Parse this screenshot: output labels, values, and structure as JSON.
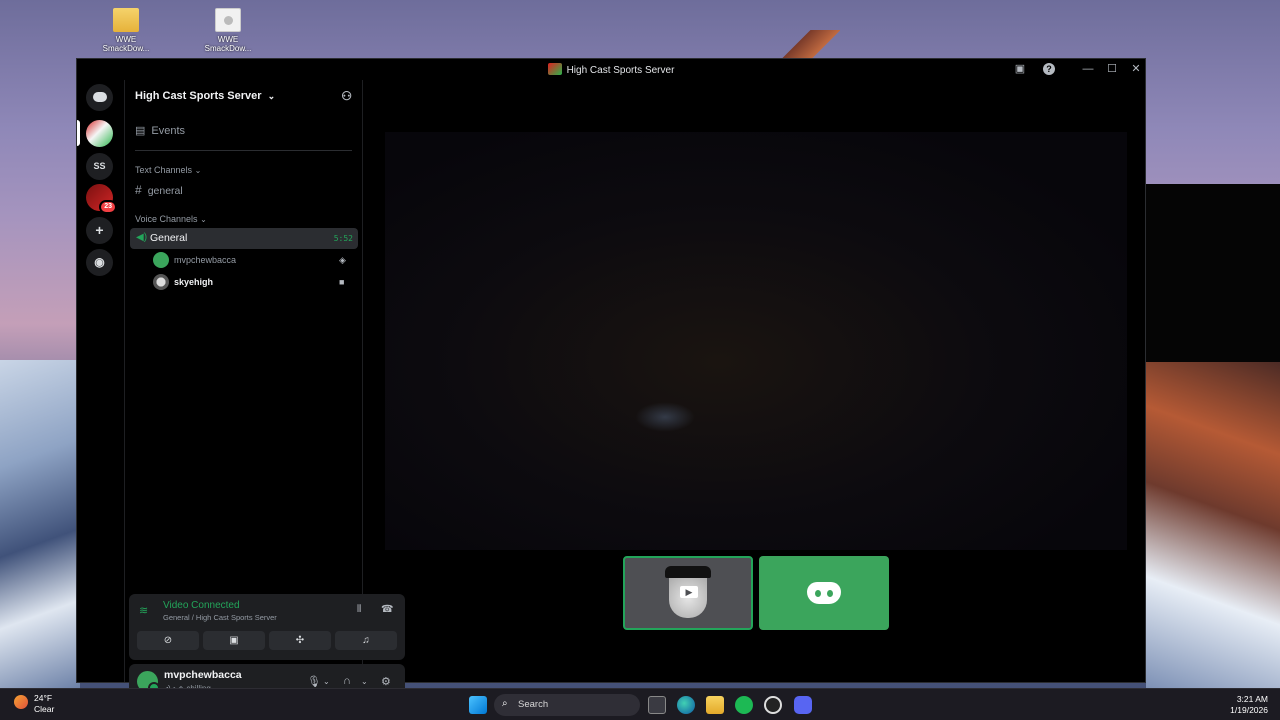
{
  "desktop": {
    "icons": [
      {
        "label": "WWE SmackDow..."
      },
      {
        "label": "WWE SmackDow..."
      }
    ]
  },
  "window": {
    "title": "High Cast Sports Server",
    "controls": {
      "inbox": "▣",
      "help": "?",
      "minimize": "—",
      "maximize": "☐",
      "close": "✕"
    }
  },
  "rail": {
    "servers": [
      {
        "short": "SS"
      }
    ],
    "badge_count": "23"
  },
  "sidebar": {
    "server_name": "High Cast Sports Server",
    "events_label": "Events",
    "text_category": "Text Channels",
    "text_channels": [
      "general"
    ],
    "voice_category": "Voice Channels",
    "voice_channel": {
      "name": "General",
      "timer": "5:52"
    },
    "voice_users": [
      {
        "name": "mvpchewbacca"
      },
      {
        "name": "skyehigh"
      }
    ]
  },
  "voice_panel": {
    "status": "Video Connected",
    "subtitle": "General / High Cast Sports Server"
  },
  "user_panel": {
    "username": "mvpchewbacca",
    "status": "chilling"
  },
  "taskbar": {
    "weather_temp": "24°F",
    "weather_desc": "Clear",
    "search_placeholder": "Search",
    "time": "3:21 AM",
    "date": "1/19/2026"
  },
  "colors": {
    "accent_green": "#23a55a",
    "tile_green": "#3ba55c",
    "panel": "#1e1f22",
    "background": "#000000"
  }
}
